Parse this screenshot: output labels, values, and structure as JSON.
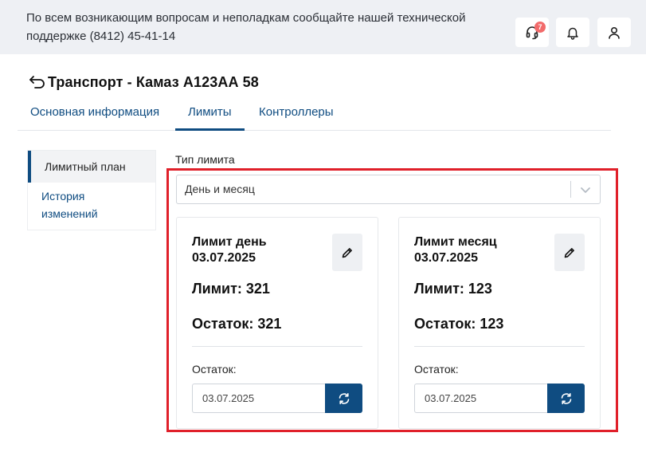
{
  "topbar": {
    "notice": "По всем возникающим вопросам и неполадкам сообщайте нашей технической поддержке (8412) 45-41-14",
    "support_badge": "7",
    "icons": [
      "headset-icon",
      "bell-icon",
      "user-icon"
    ]
  },
  "page": {
    "title": "Транспорт - Камаз А123АА 58"
  },
  "tabs": [
    {
      "label": "Основная информация",
      "active": false
    },
    {
      "label": "Лимиты",
      "active": true
    },
    {
      "label": "Контроллеры",
      "active": false
    }
  ],
  "sidebar": {
    "items": [
      {
        "label": "Лимитный план",
        "active": true
      },
      {
        "label": "История изменений",
        "active": false
      }
    ]
  },
  "limit_type": {
    "label": "Тип лимита",
    "value": "День и месяц"
  },
  "cards": [
    {
      "title": "Лимит день 03.07.2025",
      "limit": "Лимит: 321",
      "rest": "Остаток: 321",
      "rest_label": "Остаток:",
      "date": "03.07.2025"
    },
    {
      "title": "Лимит месяц 03.07.2025",
      "limit": "Лимит: 123",
      "rest": "Остаток: 123",
      "rest_label": "Остаток:",
      "date": "03.07.2025"
    }
  ],
  "colors": {
    "accent": "#0f4c81",
    "topbar_bg": "#eef0f4",
    "highlight": "#e0202a",
    "badge": "#f26b6b"
  }
}
